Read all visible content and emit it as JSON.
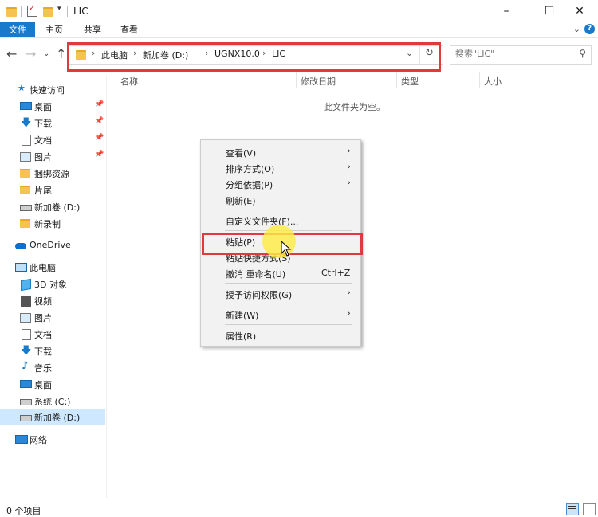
{
  "window": {
    "title": "LIC"
  },
  "ribbon": {
    "tabs": [
      "文件",
      "主页",
      "共享",
      "查看"
    ]
  },
  "address": {
    "crumbs": [
      "此电脑",
      "新加卷 (D:)",
      "UGNX10.0",
      "LIC"
    ]
  },
  "search": {
    "placeholder": "搜索\"LIC\""
  },
  "nav": {
    "items": [
      {
        "label": "快速访问",
        "icon": "star-icon"
      },
      {
        "label": "桌面",
        "icon": "desktop-icon",
        "pinned": true
      },
      {
        "label": "下载",
        "icon": "download-icon",
        "pinned": true
      },
      {
        "label": "文档",
        "icon": "document-icon",
        "pinned": true
      },
      {
        "label": "图片",
        "icon": "pictures-icon",
        "pinned": true
      },
      {
        "label": "捆绑资源",
        "icon": "folder-icon"
      },
      {
        "label": "片尾",
        "icon": "folder-icon"
      },
      {
        "label": "新加卷 (D:)",
        "icon": "drive-icon"
      },
      {
        "label": "新录制",
        "icon": "folder-icon"
      },
      {
        "label": "OneDrive",
        "icon": "cloud-icon"
      },
      {
        "label": "此电脑",
        "icon": "pc-icon"
      },
      {
        "label": "3D 对象",
        "icon": "3d-objects-icon"
      },
      {
        "label": "视频",
        "icon": "video-icon"
      },
      {
        "label": "图片",
        "icon": "pictures-icon"
      },
      {
        "label": "文档",
        "icon": "document-icon"
      },
      {
        "label": "下载",
        "icon": "download-icon"
      },
      {
        "label": "音乐",
        "icon": "music-icon"
      },
      {
        "label": "桌面",
        "icon": "desktop-icon"
      },
      {
        "label": "系统 (C:)",
        "icon": "drive-icon"
      },
      {
        "label": "新加卷 (D:)",
        "icon": "drive-icon",
        "selected": true
      },
      {
        "label": "网络",
        "icon": "network-icon"
      }
    ]
  },
  "columns": [
    "名称",
    "修改日期",
    "类型",
    "大小"
  ],
  "content": {
    "empty_message": "此文件夹为空。"
  },
  "context_menu": {
    "items": [
      {
        "label": "查看(V)",
        "submenu": true
      },
      {
        "label": "排序方式(O)",
        "submenu": true
      },
      {
        "label": "分组依据(P)",
        "submenu": true
      },
      {
        "label": "刷新(E)"
      },
      {
        "label": "自定义文件夹(F)..."
      },
      {
        "label": "粘贴(P)",
        "highlighted": true
      },
      {
        "label": "粘贴快捷方式(S)"
      },
      {
        "label": "撤消 重命名(U)",
        "shortcut": "Ctrl+Z"
      },
      {
        "label": "授予访问权限(G)",
        "submenu": true
      },
      {
        "label": "新建(W)",
        "submenu": true
      },
      {
        "label": "属性(R)"
      }
    ]
  },
  "status": {
    "item_count": "0 个项目"
  },
  "colors": {
    "accent": "#1979ca",
    "highlight_box": "#e03a3e",
    "cursor_glow": "#ffec46"
  }
}
